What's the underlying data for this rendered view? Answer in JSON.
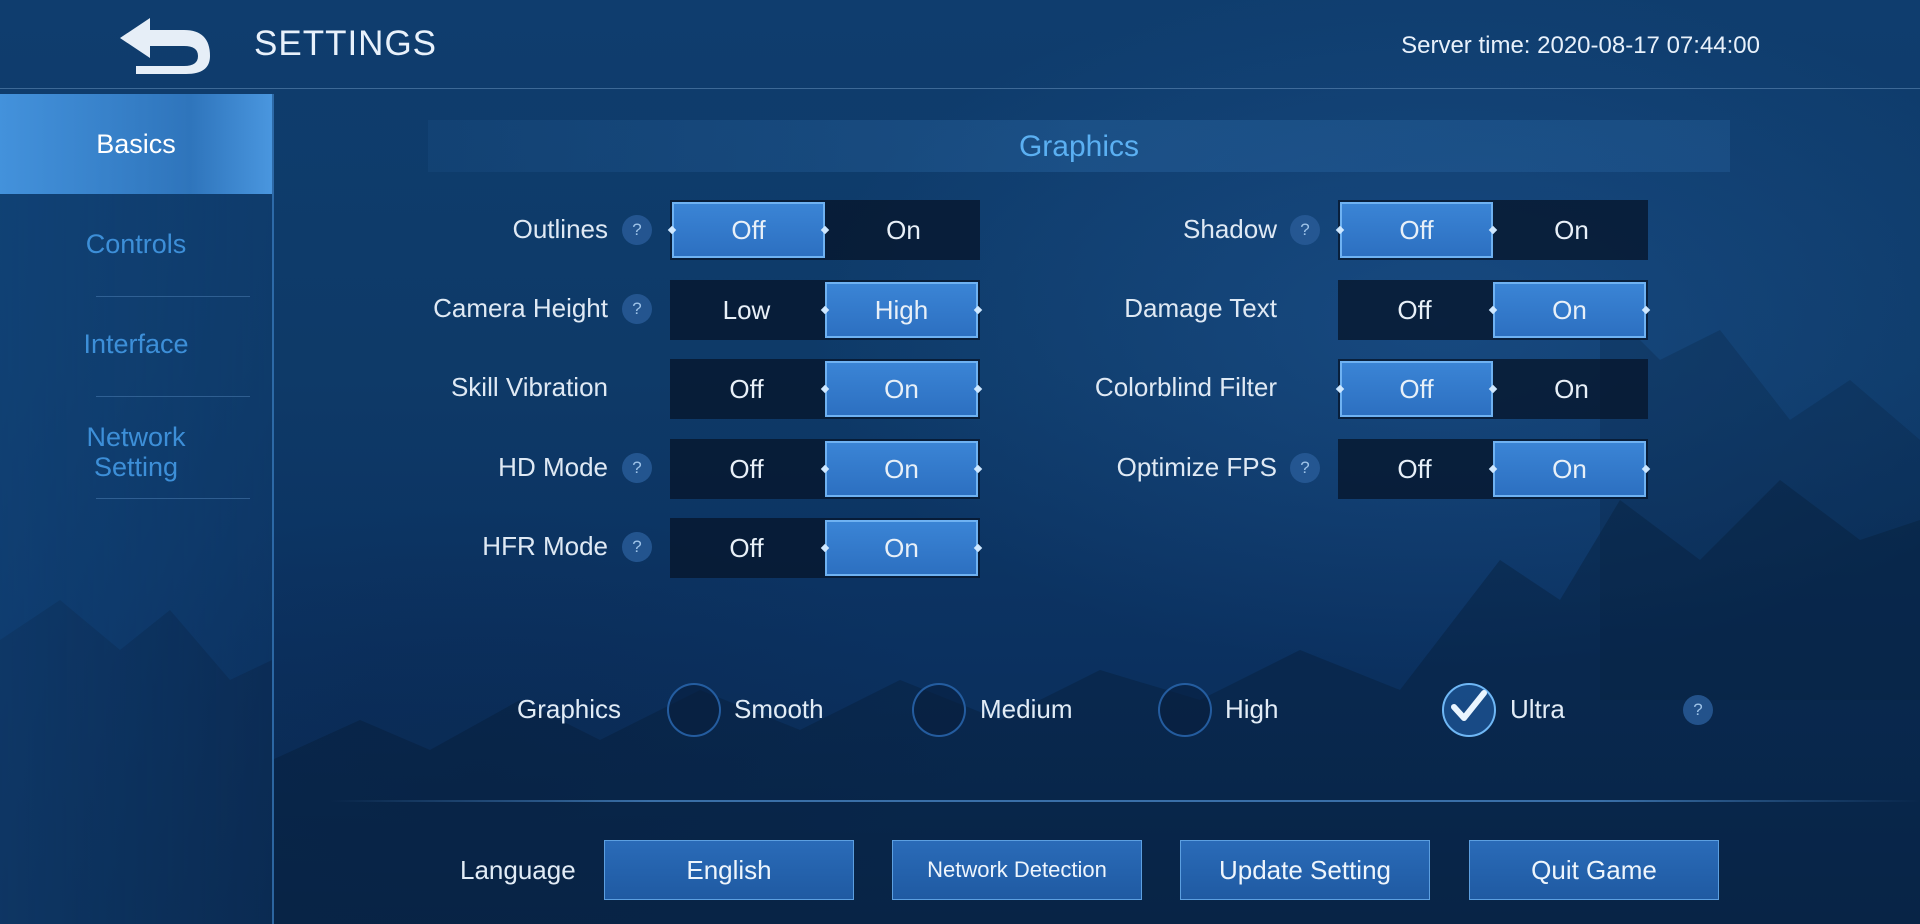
{
  "header": {
    "title": "SETTINGS",
    "server_time": "Server time: 2020-08-17 07:44:00"
  },
  "sidebar": {
    "items": [
      {
        "label": "Basics"
      },
      {
        "label": "Controls"
      },
      {
        "label": "Interface"
      },
      {
        "label": "Network Setting"
      }
    ]
  },
  "section": {
    "title": "Graphics"
  },
  "settings": {
    "outlines": {
      "label": "Outlines",
      "options": [
        "Off",
        "On"
      ]
    },
    "camera_height": {
      "label": "Camera Height",
      "options": [
        "Low",
        "High"
      ]
    },
    "skill_vibration": {
      "label": "Skill Vibration",
      "options": [
        "Off",
        "On"
      ]
    },
    "hd_mode": {
      "label": "HD Mode",
      "options": [
        "Off",
        "On"
      ]
    },
    "hfr_mode": {
      "label": "HFR Mode",
      "options": [
        "Off",
        "On"
      ]
    },
    "shadow": {
      "label": "Shadow",
      "options": [
        "Off",
        "On"
      ]
    },
    "damage_text": {
      "label": "Damage Text",
      "options": [
        "Off",
        "On"
      ]
    },
    "colorblind_filter": {
      "label": "Colorblind Filter",
      "options": [
        "Off",
        "On"
      ]
    },
    "optimize_fps": {
      "label": "Optimize FPS",
      "options": [
        "Off",
        "On"
      ]
    }
  },
  "help_glyph": "?",
  "graphics_quality": {
    "label": "Graphics",
    "options": [
      "Smooth",
      "Medium",
      "High",
      "Ultra"
    ],
    "selected": "Ultra"
  },
  "bottom": {
    "language_label": "Language",
    "language_value": "English",
    "network_detection": "Network Detection",
    "update_setting": "Update Setting",
    "quit_game": "Quit Game"
  },
  "colors": {
    "accent": "#5bb0f2",
    "selected": "#3b85d6",
    "background": "#0e3a68"
  }
}
